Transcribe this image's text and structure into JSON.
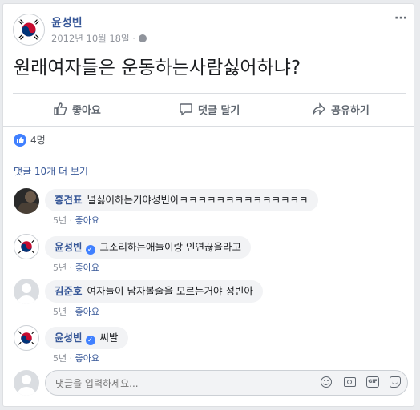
{
  "post": {
    "author": "윤성빈",
    "date": "2012년 10월 18일",
    "dot": "·",
    "text": "원래여자들은 운동하는사람싫어하냐?",
    "more": "···"
  },
  "actions": {
    "like": "좋아요",
    "comment": "댓글 달기",
    "share": "공유하기"
  },
  "reactions": {
    "count": "4명"
  },
  "view_more": "댓글 10개 더 보기",
  "comments": [
    {
      "name": "홍견표",
      "text": "널싫어하는거야성빈아ㅋㅋㅋㅋㅋㅋㅋㅋㅋㅋㅋㅋㅋㅋ",
      "time": "5년",
      "like": "좋아요"
    },
    {
      "name": "윤성빈",
      "text": "그소리하는애들이랑 인연끊을라고",
      "time": "5년",
      "like": "좋아요"
    },
    {
      "name": "김준호",
      "text": "여자들이 남자볼줄을 모르는거야 성빈아",
      "time": "5년",
      "like": "좋아요"
    },
    {
      "name": "윤성빈",
      "text": "씨발",
      "time": "5년",
      "like": "좋아요"
    }
  ],
  "meta_dot": "·",
  "composer": {
    "placeholder": "댓글을 입력하세요..."
  },
  "colors": {
    "link": "#385898",
    "accent": "#4267b2",
    "muted": "#90949c"
  }
}
